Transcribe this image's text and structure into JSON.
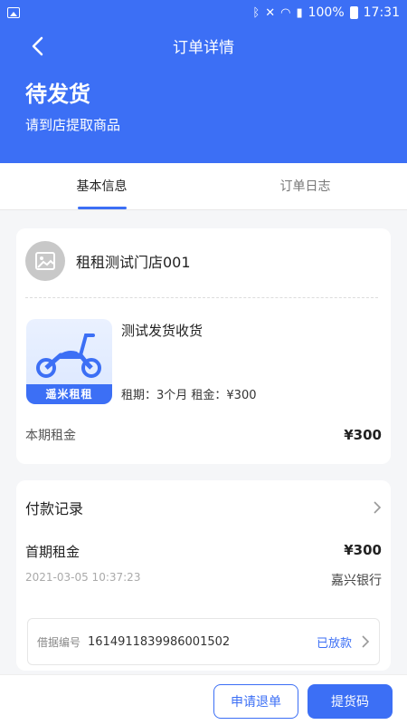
{
  "status_bar": {
    "battery": "100%",
    "time": "17:31"
  },
  "header": {
    "title": "订单详情",
    "status_title": "待发货",
    "status_sub": "请到店提取商品"
  },
  "tabs": [
    {
      "label": "基本信息",
      "active": true
    },
    {
      "label": "订单日志",
      "active": false
    }
  ],
  "store": {
    "name": "租租测试门店001"
  },
  "product": {
    "name": "测试发货收货",
    "terms": "租期：3个月 租金：¥300",
    "brand_text": "遥米租租"
  },
  "current_rent": {
    "label": "本期租金",
    "value": "¥300"
  },
  "payment": {
    "title": "付款记录",
    "first_label": "首期租金",
    "first_value": "¥300",
    "time": "2021-03-05 10:37:23",
    "bank": "嘉兴银行",
    "receipt_label": "借据编号",
    "receipt_no": "1614911839986001502",
    "receipt_status": "已放款"
  },
  "actions": {
    "refund": "申请退单",
    "pickup_code": "提货码"
  },
  "colors": {
    "primary": "#3c6ff5"
  }
}
